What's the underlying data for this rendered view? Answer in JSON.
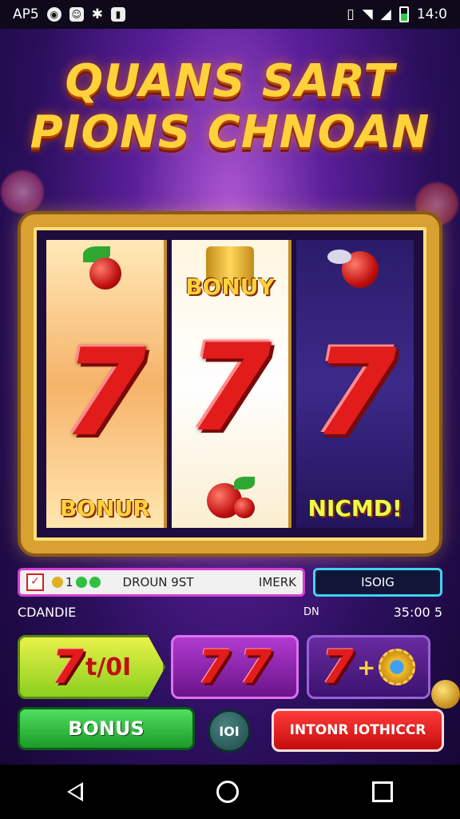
{
  "status_bar": {
    "left_text": "AP5",
    "time": "14:0",
    "icons": [
      "notification-icon",
      "smile-icon",
      "bluetooth-icon",
      "app-icon",
      "vibrate-icon",
      "wifi-icon",
      "signal-icon",
      "battery-icon"
    ]
  },
  "title": {
    "line1": "QUANS SART",
    "line2": "PIONS CHNOAN"
  },
  "reels": [
    {
      "top": "cherry-fruit",
      "middle": "7",
      "bottom_label": "BONUR"
    },
    {
      "top_label": "BONUY",
      "middle": "7",
      "bottom": "cherry-fruit"
    },
    {
      "top": "cherry-fruit",
      "middle": "7",
      "bottom_label": "NICMD!"
    }
  ],
  "info_bar": {
    "counter": "1",
    "label": "DROUN 9ST",
    "mode": "IMERK",
    "right_value": "ISOIG"
  },
  "row2": {
    "left": "CDANDIE",
    "mid": "DN",
    "right": "35:00 5"
  },
  "cards": {
    "card1_seven": "7",
    "card1_text": "t/0I",
    "card2_seven_a": "7",
    "card2_seven_b": "7",
    "card3_seven": "7",
    "card3_plus": "+"
  },
  "buttons": {
    "bonus": "BONUS",
    "middle": "IOI",
    "red": "INTONR IOTHICCR"
  },
  "colors": {
    "accent_gold": "#ffd23a",
    "seven_red": "#e21b1b",
    "bonus_green": "#1c9a28",
    "red_button": "#c40d0d"
  }
}
